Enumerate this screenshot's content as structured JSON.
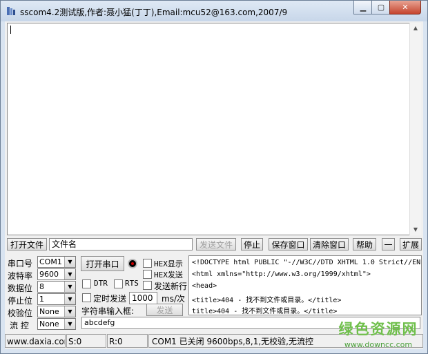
{
  "window": {
    "title": "sscom4.2测试版,作者:聂小猛(丁丁),Email:mcu52@163.com,2007/9",
    "min_label": "▁",
    "max_label": "▢",
    "close_label": "✕"
  },
  "file_row": {
    "open_file": "打开文件",
    "file_name": "文件名",
    "send_file": "发送文件",
    "stop": "停止",
    "save_window": "保存窗口",
    "clear_window": "清除窗口",
    "help": "帮助",
    "collapse": "一",
    "expand": "扩展"
  },
  "port_settings": {
    "port_label": "串口号",
    "port_value": "COM1",
    "baud_label": "波特率",
    "baud_value": "9600",
    "databits_label": "数据位",
    "databits_value": "8",
    "stopbits_label": "停止位",
    "stopbits_value": "1",
    "parity_label": "校验位",
    "parity_value": "None",
    "flow_label": "流 控",
    "flow_value": "None"
  },
  "controls": {
    "open_port": "打开串口",
    "hex_display": "HEX显示",
    "hex_send": "HEX发送",
    "dtr": "DTR",
    "rts": "RTS",
    "send_newline": "发送新行",
    "timed_send": "定时发送",
    "interval": "1000",
    "interval_unit": "ms/次",
    "string_input_label": "字符串输入框:",
    "send": "发送",
    "string_input_value": "abcdefg"
  },
  "send_area": {
    "lines": [
      "<!DOCTYPE html PUBLIC \"-//W3C//DTD XHTML 1.0 Strict//EN\"",
      "<html xmlns=\"http://www.w3.org/1999/xhtml\">",
      "<head>",
      "<title>404 - 找不到文件或目录。</title>",
      "title>404 - 找不到文件或目录。</title>"
    ]
  },
  "status_bar": {
    "website": "www.daxia.cor",
    "sent": "S:0",
    "received": "R:0",
    "port_status": "COM1 已关闭  9600bps,8,1,无校验,无流控"
  },
  "watermark": {
    "name": "绿色资源网",
    "url": "www.downcc.com"
  }
}
